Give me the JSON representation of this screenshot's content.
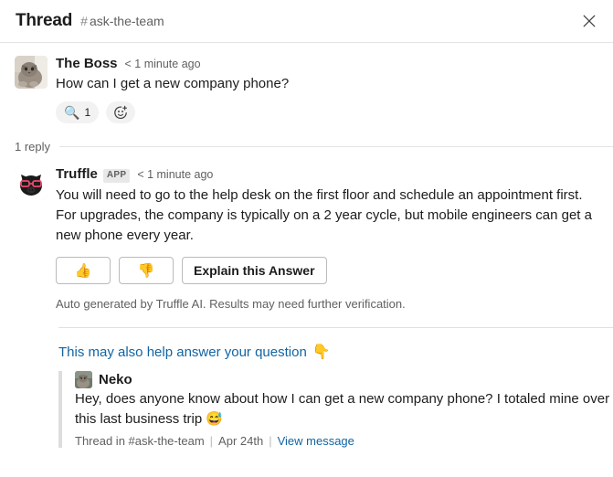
{
  "header": {
    "title": "Thread",
    "hash": "#",
    "channel": "ask-the-team",
    "close_icon": "close-icon"
  },
  "root_message": {
    "author": "The Boss",
    "timestamp": "< 1 minute ago",
    "text": "How can I get a new company phone?",
    "avatar_icon": "cat-photo-avatar",
    "reactions": [
      {
        "emoji": "🔍",
        "count": "1"
      }
    ],
    "add_reaction_label": "add-reaction"
  },
  "reply_divider": {
    "label": "1 reply"
  },
  "bot_message": {
    "author": "Truffle",
    "badge": "APP",
    "timestamp": "< 1 minute ago",
    "avatar_icon": "truffle-pig-avatar",
    "text": "You will need to go to the help desk on the first floor and schedule an appointment first. For upgrades, the company is typically on a 2 year cycle, but mobile engineers can get a new phone every year.",
    "buttons": [
      {
        "name": "thumbs-up-button",
        "label": "👍"
      },
      {
        "name": "thumbs-down-button",
        "label": "👎"
      },
      {
        "name": "explain-answer-button",
        "label": "Explain this Answer"
      }
    ],
    "disclaimer": "Auto generated by Truffle AI. Results may need further verification."
  },
  "suggestion": {
    "link_text": "This may also help answer your question",
    "point_emoji": "👇",
    "quote": {
      "author": "Neko",
      "avatar_icon": "neko-photo-avatar",
      "text": "Hey, does anyone know about how I can get a new company phone? I totaled mine over this last business trip 😅",
      "meta_prefix": "Thread in",
      "hash": "#",
      "channel": "ask-the-team",
      "date": "Apr 24th",
      "view_link": "View message"
    }
  },
  "colors": {
    "link": "#1264a3",
    "text": "#1d1c1d",
    "muted": "#616061",
    "border": "#e4e4e4"
  }
}
